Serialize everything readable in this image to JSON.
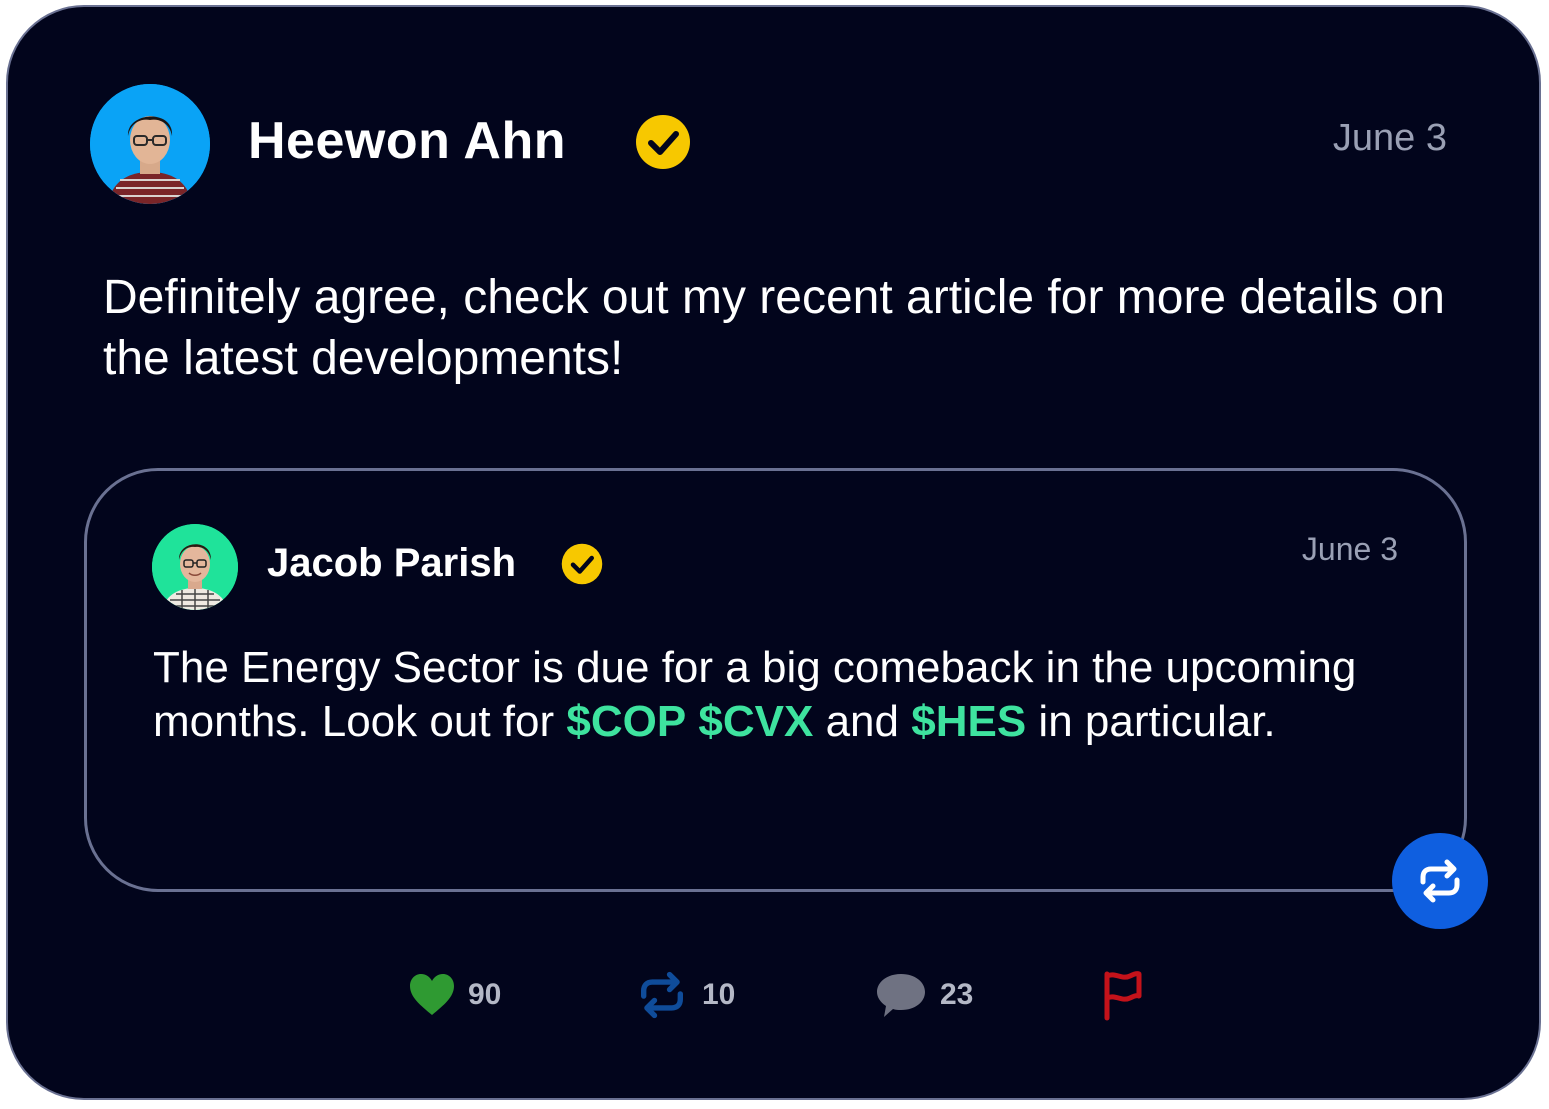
{
  "post": {
    "author": {
      "name": "Heewon Ahn",
      "verified": true,
      "avatar_bg": "#0aa3f6"
    },
    "date": "June 3",
    "body": "Definitely agree, check out my recent article for more details on the latest developments!"
  },
  "quoted_post": {
    "author": {
      "name": "Jacob Parish",
      "verified": true,
      "avatar_bg": "#1fe39a"
    },
    "date": "June 3",
    "body": {
      "text_1": "The Energy Sector is due for a big comeback in the upcoming months. Look out for ",
      "ticker_1": "$COP",
      "text_2": " ",
      "ticker_2": "$CVX",
      "text_3": " and ",
      "ticker_3": "$HES",
      "text_4": " in particular."
    }
  },
  "actions": {
    "likes": "90",
    "reposts": "10",
    "comments": "23"
  },
  "colors": {
    "card_bg": "#02051c",
    "border": "#6a7192",
    "verified_badge": "#f7c800",
    "ticker": "#3ee39f",
    "like_icon": "#2f9a32",
    "repost_icon": "#0f4c9a",
    "comment_icon": "#6f7282",
    "report_icon": "#c4121a",
    "repost_fab": "#0f5fe0"
  },
  "icons": {
    "verified": "verified-check-icon",
    "like": "heart-icon",
    "repost": "repost-icon",
    "comment": "comment-bubble-icon",
    "report": "flag-icon"
  }
}
